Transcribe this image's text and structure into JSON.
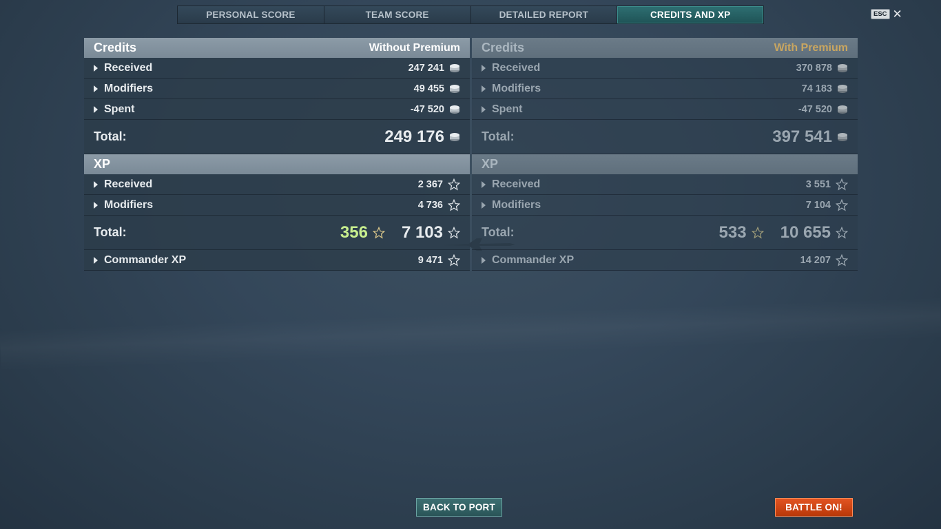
{
  "tabs": [
    {
      "label": "PERSONAL SCORE",
      "active": false
    },
    {
      "label": "TEAM SCORE",
      "active": false
    },
    {
      "label": "DETAILED REPORT",
      "active": false
    },
    {
      "label": "CREDITS AND XP",
      "active": true
    }
  ],
  "esc_label": "ESC",
  "left": {
    "credits_title": "Credits",
    "credits_subtitle": "Without Premium",
    "credits_rows": [
      {
        "label": "Received",
        "value": "247 241"
      },
      {
        "label": "Modifiers",
        "value": "49 455"
      },
      {
        "label": "Spent",
        "value": "-47 520"
      }
    ],
    "credits_total_label": "Total:",
    "credits_total": "249 176",
    "xp_title": "XP",
    "xp_rows": [
      {
        "label": "Received",
        "value": "2 367"
      },
      {
        "label": "Modifiers",
        "value": "4 736"
      }
    ],
    "xp_total_label": "Total:",
    "xp_bonus": "356",
    "xp_total": "7 103",
    "commander_label": "Commander XP",
    "commander_value": "9 471"
  },
  "right": {
    "credits_title": "Credits",
    "credits_subtitle": "With Premium",
    "credits_rows": [
      {
        "label": "Received",
        "value": "370 878"
      },
      {
        "label": "Modifiers",
        "value": "74 183"
      },
      {
        "label": "Spent",
        "value": "-47 520"
      }
    ],
    "credits_total_label": "Total:",
    "credits_total": "397 541",
    "xp_title": "XP",
    "xp_rows": [
      {
        "label": "Received",
        "value": "3 551"
      },
      {
        "label": "Modifiers",
        "value": "7 104"
      }
    ],
    "xp_total_label": "Total:",
    "xp_bonus": "533",
    "xp_total": "10 655",
    "commander_label": "Commander XP",
    "commander_value": "14 207"
  },
  "buttons": {
    "back_to_port": "BACK TO PORT",
    "battle_on": "BATTLE ON!"
  },
  "colors": {
    "active_tab": "#2e6f72",
    "premium_gold": "#c9a660",
    "bonus_green": "#c8ef8e",
    "battle_button": "#d2471a"
  },
  "icons": {
    "credits": "coin-stack-icon",
    "xp": "star-icon",
    "expand": "caret-right-icon",
    "close": "close-icon"
  }
}
